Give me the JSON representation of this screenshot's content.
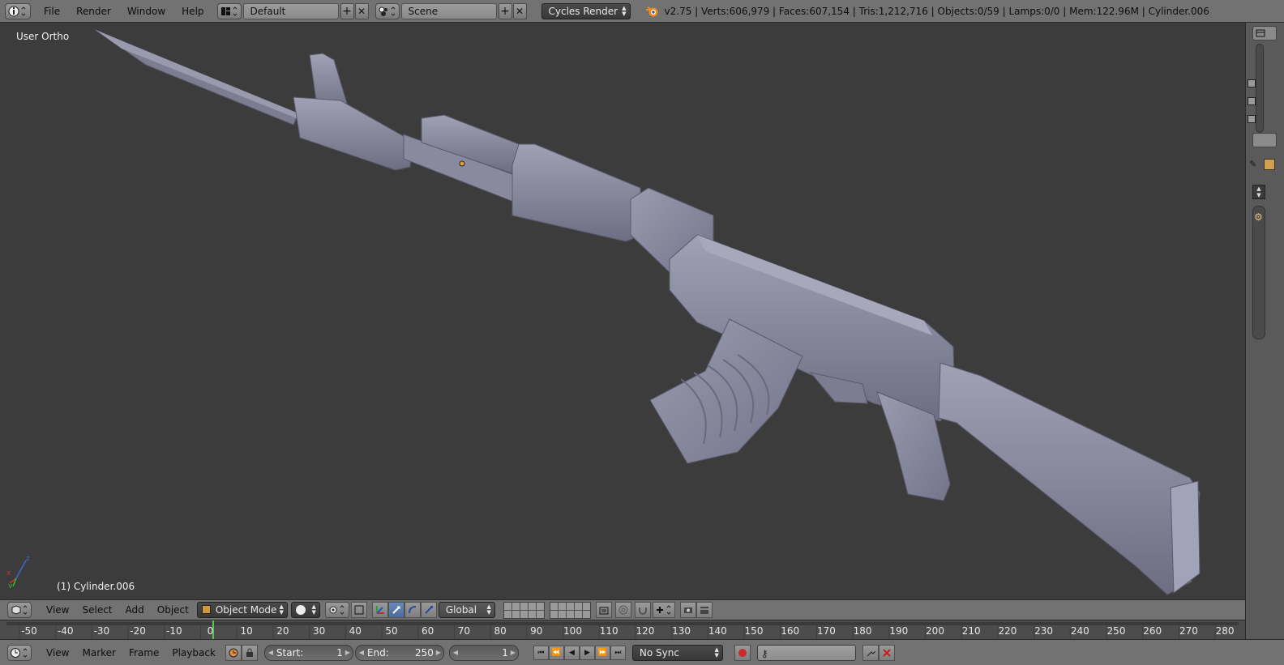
{
  "topbar": {
    "menus": [
      "File",
      "Render",
      "Window",
      "Help"
    ],
    "screen_layout": "Default",
    "scene": "Scene",
    "render_engine": "Cycles Render",
    "stats": "v2.75 | Verts:606,979 | Faces:607,154 | Tris:1,212,716 | Objects:0/59 | Lamps:0/0 | Mem:122.96M | Cylinder.006"
  },
  "viewport": {
    "view_label": "User Ortho",
    "object_label": "(1) Cylinder.006"
  },
  "view3d_header": {
    "menus": [
      "View",
      "Select",
      "Add",
      "Object"
    ],
    "mode": "Object Mode",
    "orientation": "Global"
  },
  "timeline": {
    "ticks": [
      "-50",
      "-40",
      "-30",
      "-20",
      "-10",
      "0",
      "10",
      "20",
      "30",
      "40",
      "50",
      "60",
      "70",
      "80",
      "90",
      "100",
      "110",
      "120",
      "130",
      "140",
      "150",
      "160",
      "170",
      "180",
      "190",
      "200",
      "210",
      "220",
      "230",
      "240",
      "250",
      "260",
      "270",
      "280"
    ]
  },
  "time_header": {
    "menus": [
      "View",
      "Marker",
      "Frame",
      "Playback"
    ],
    "start_label": "Start:",
    "start_value": "1",
    "end_label": "End:",
    "end_value": "250",
    "current_frame": "1",
    "sync": "No Sync"
  },
  "colors": {
    "background": "#3c3c3c",
    "header": "#727272",
    "model": "#8a8aa0",
    "active_button": "#5a7aaa",
    "record": "#cc2a2a"
  }
}
